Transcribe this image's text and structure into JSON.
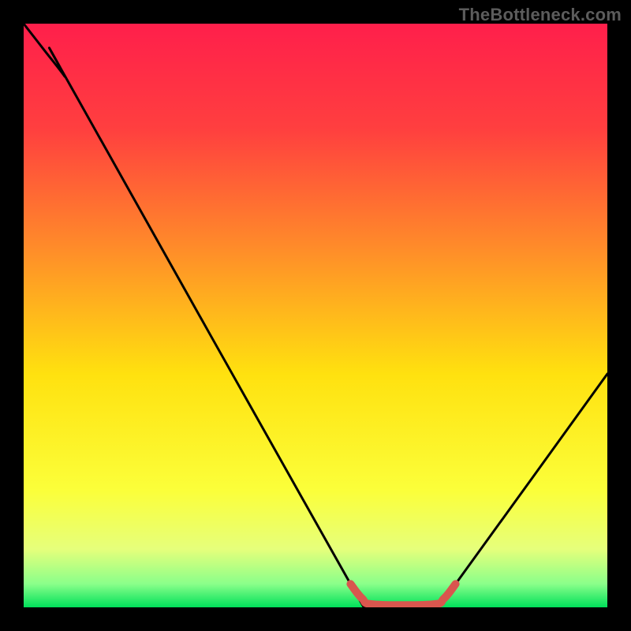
{
  "watermark": "TheBottleneck.com",
  "gradient_stops": [
    {
      "offset": 0,
      "color": "#ff1f4b"
    },
    {
      "offset": 0.18,
      "color": "#ff3f3f"
    },
    {
      "offset": 0.38,
      "color": "#ff8a2a"
    },
    {
      "offset": 0.6,
      "color": "#ffe10f"
    },
    {
      "offset": 0.8,
      "color": "#fbff3a"
    },
    {
      "offset": 0.9,
      "color": "#e6ff7b"
    },
    {
      "offset": 0.96,
      "color": "#8aff8a"
    },
    {
      "offset": 1.0,
      "color": "#00e05a"
    }
  ],
  "chart_data": {
    "type": "line",
    "title": "",
    "xlabel": "",
    "ylabel": "",
    "xlim": [
      0,
      100
    ],
    "ylim": [
      0,
      100
    ],
    "grid": false,
    "series": [
      {
        "name": "bottleneck-curve",
        "points": [
          {
            "x": 0,
            "y": 100
          },
          {
            "x": 3.5,
            "y": 95.5
          },
          {
            "x": 7,
            "y": 91
          },
          {
            "x": 8.5,
            "y": 88.5
          },
          {
            "x": 56,
            "y": 4
          },
          {
            "x": 58,
            "y": 1.5
          },
          {
            "x": 60,
            "y": 0.5
          },
          {
            "x": 70,
            "y": 0.5
          },
          {
            "x": 72,
            "y": 1.5
          },
          {
            "x": 74,
            "y": 4
          },
          {
            "x": 100,
            "y": 40
          }
        ]
      },
      {
        "name": "highlight-band",
        "color": "#d9564e",
        "points": [
          {
            "x": 56,
            "y": 4
          },
          {
            "x": 58,
            "y": 1.5
          },
          {
            "x": 60,
            "y": 0.5
          },
          {
            "x": 70,
            "y": 0.5
          },
          {
            "x": 72,
            "y": 1.5
          },
          {
            "x": 74,
            "y": 4
          }
        ]
      }
    ]
  }
}
